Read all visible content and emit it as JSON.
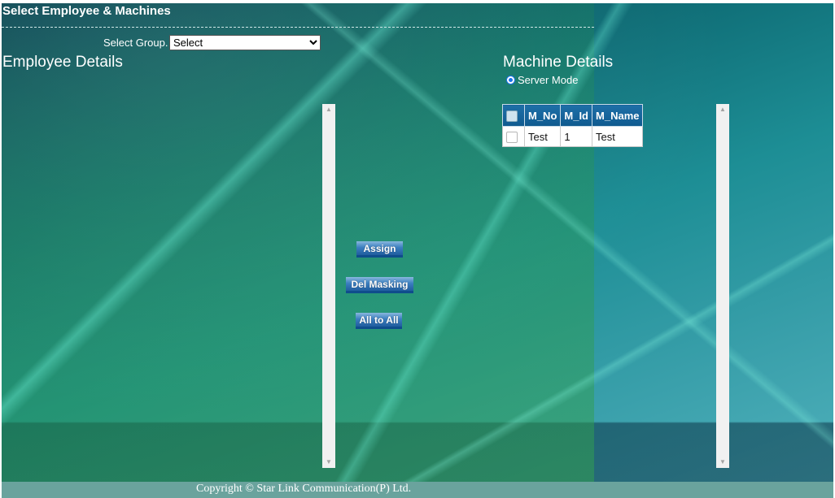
{
  "header": {
    "title": "Select Employee & Machines"
  },
  "group": {
    "label": "Select Group.",
    "selected": "Select"
  },
  "employee": {
    "title": "Employee Details"
  },
  "machine": {
    "title": "Machine Details",
    "mode_label": "Server Mode",
    "columns": [
      "M_No",
      "M_Id",
      "M_Name"
    ],
    "rows": [
      {
        "no": "Test",
        "id": "1",
        "name": "Test"
      }
    ]
  },
  "actions": {
    "assign": "Assign",
    "del_masking": "Del Masking",
    "all_to_all": "All to All"
  },
  "footer": {
    "copyright": "Copyright © Star Link Communication(P) Ltd."
  }
}
